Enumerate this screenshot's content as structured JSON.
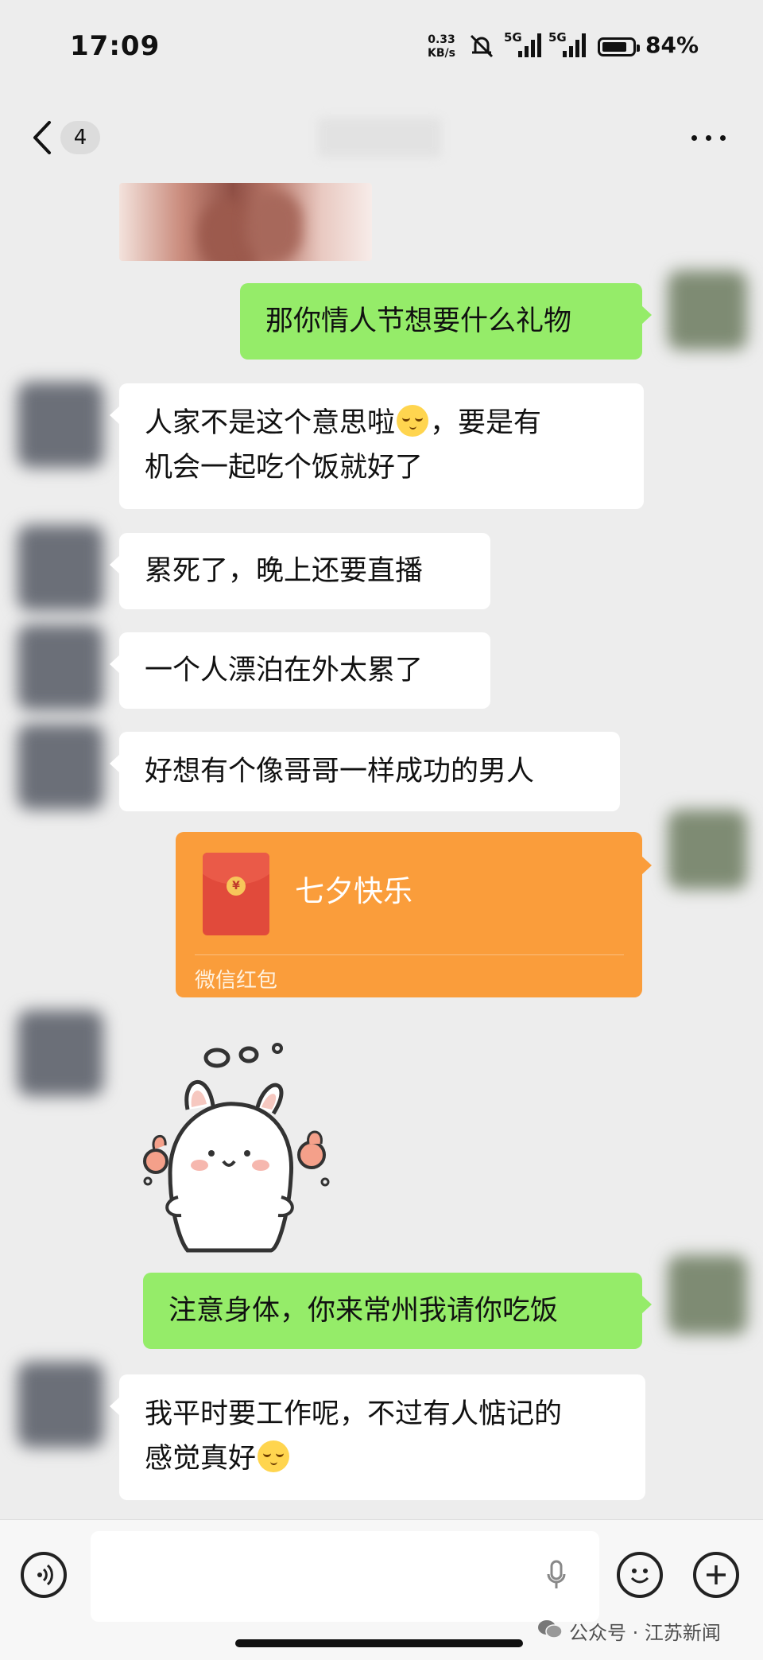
{
  "status_bar": {
    "time": "17:09",
    "net_speed_value": "0.33",
    "net_speed_unit": "KB/s",
    "sim1_label": "5G",
    "sim2_label": "5G",
    "battery_percent": "84%",
    "battery_level": 0.84
  },
  "nav": {
    "unread_count": "4"
  },
  "messages": [
    {
      "side": "out",
      "text": "那你情人节想要什么礼物"
    },
    {
      "side": "in",
      "text_line1": "人家不是这个意思啦",
      "text_line1b": "，要是有",
      "text_line2": "机会一起吃个饭就好了"
    },
    {
      "side": "in",
      "text": "累死了，晚上还要直播"
    },
    {
      "side": "in",
      "text": "一个人漂泊在外太累了"
    },
    {
      "side": "in",
      "text": "好想有个像哥哥一样成功的男人"
    },
    {
      "side": "out",
      "type": "red_packet",
      "title": "七夕快乐",
      "caption": "微信红包",
      "coin": "¥"
    },
    {
      "side": "in",
      "type": "sticker"
    },
    {
      "side": "out",
      "text": "注意身体，你来常州我请你吃饭"
    },
    {
      "side": "in",
      "text_line1": "我平时要工作呢，不过有人惦记的",
      "text_line2": "感觉真好"
    }
  ],
  "input_bar": {
    "input_value": "",
    "watermark": "公众号 · 江苏新闻"
  },
  "colors": {
    "background": "#ededed",
    "outgoing_bubble": "#95ec69",
    "incoming_bubble": "#ffffff",
    "red_packet": "#fa9d3b"
  },
  "icons": [
    "back-icon",
    "more-icon",
    "voice-icon",
    "mic-icon",
    "emoji-icon",
    "plus-icon",
    "wechat-icon",
    "mute-icon",
    "battery-icon"
  ]
}
